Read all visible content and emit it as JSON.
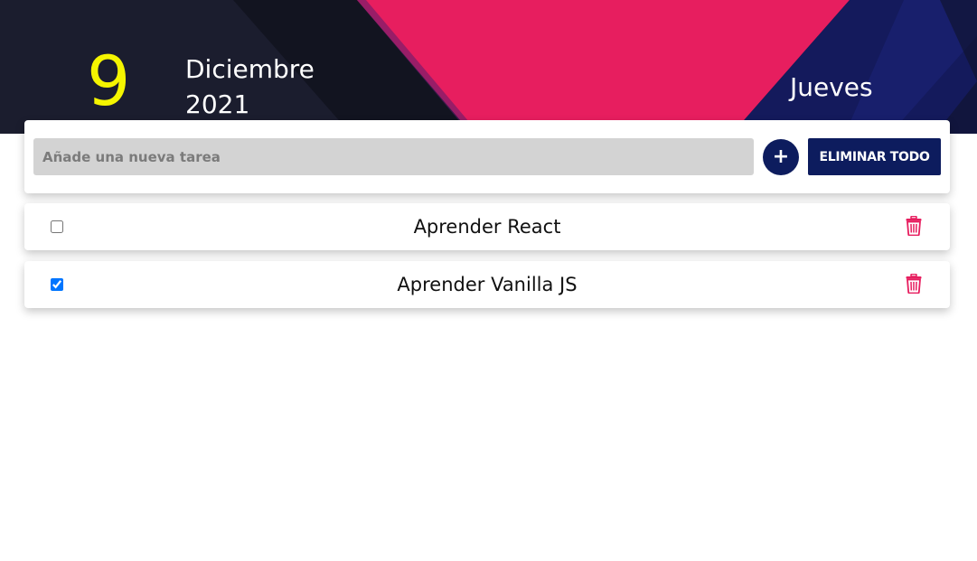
{
  "header": {
    "day": "9",
    "month": "Diciembre",
    "year": "2021",
    "weekday": "Jueves"
  },
  "form": {
    "placeholder": "Añade una nueva tarea",
    "value": "",
    "add_label": "+",
    "clear_label": "ELIMINAR TODO"
  },
  "tasks": [
    {
      "text": "Aprender React",
      "done": false
    },
    {
      "text": "Aprender Vanilla JS",
      "done": true
    }
  ],
  "colors": {
    "header_dark": "#1b1d2e",
    "header_pink": "#e71e5f",
    "header_navy": "#141a5c",
    "day_yellow": "#f5f500",
    "button_navy": "#0d1c5e",
    "trash_pink": "#e71e5f"
  },
  "icons": {
    "trash": "trash-icon",
    "add": "plus-icon"
  }
}
